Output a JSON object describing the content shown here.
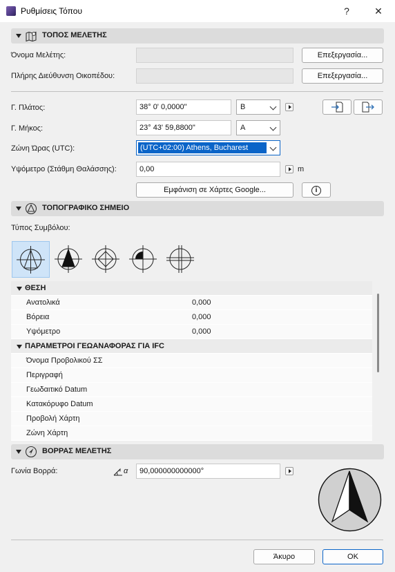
{
  "window": {
    "title": "Ρυθμίσεις Τόπου",
    "help": "?",
    "close": "✕"
  },
  "sections": {
    "project": "ΤΟΠΟΣ ΜΕΛΕΤΗΣ",
    "survey": "ΤΟΠΟΓΡΑΦΙΚΟ ΣΗΜΕΙΟ",
    "north": "ΒΟΡΡΑΣ ΜΕΛΕΤΗΣ"
  },
  "project": {
    "name_label": "Όνομα Μελέτης:",
    "name_value": "",
    "address_label": "Πλήρης Διεύθυνση Οικοπέδου:",
    "address_value": "",
    "edit_button": "Επεξεργασία...",
    "lat_label": "Γ. Πλάτος:",
    "lat_value": "38° 0' 0,0000\"",
    "lat_dir": "B",
    "lon_label": "Γ. Μήκος:",
    "lon_value": "23° 43' 59,8800\"",
    "lon_dir": "A",
    "tz_label": "Ζώνη Ώρας (UTC):",
    "tz_value": "(UTC+02:00) Athens, Bucharest",
    "alt_label": "Υψόμετρο (Στάθμη Θαλάσσης):",
    "alt_value": "0,00",
    "alt_unit": "m",
    "maps_button": "Εμφάνιση σε Χάρτες Google...",
    "info_glyph": "i"
  },
  "survey": {
    "symbol_type_label": "Τύπος Συμβόλου:",
    "selected_symbol": 1,
    "symbol_count": 5
  },
  "table": {
    "groups": [
      {
        "title": "ΘΕΣΗ",
        "rows": [
          {
            "name": "Ανατολικά",
            "value": "0,000"
          },
          {
            "name": "Βόρεια",
            "value": "0,000"
          },
          {
            "name": "Υψόμετρο",
            "value": "0,000"
          }
        ]
      },
      {
        "title": "ΠΑΡΑΜΕΤΡΟΙ ΓΕΩΑΝΑΦΟΡΑΣ ΓΙΑ IFC",
        "rows": [
          {
            "name": "Όνομα Προβολικού ΣΣ",
            "value": ""
          },
          {
            "name": "Περιγραφή",
            "value": ""
          },
          {
            "name": "Γεωδαιτικό Datum",
            "value": ""
          },
          {
            "name": "Κατακόρυφο Datum",
            "value": ""
          },
          {
            "name": "Προβολή Χάρτη",
            "value": ""
          },
          {
            "name": "Ζώνη Χάρτη",
            "value": ""
          }
        ]
      }
    ]
  },
  "north": {
    "angle_label": "Γωνία Βορρά:",
    "angle_value": "90,000000000000°",
    "angle_icon_text": "α"
  },
  "footer": {
    "cancel": "Άκυρο",
    "ok": "OK"
  },
  "colors": {
    "section_bg": "#dcdcdc",
    "selection": "#0a64c8",
    "selected_symbol_bg": "#cfe4f8",
    "ok_border": "#0a64c8"
  }
}
